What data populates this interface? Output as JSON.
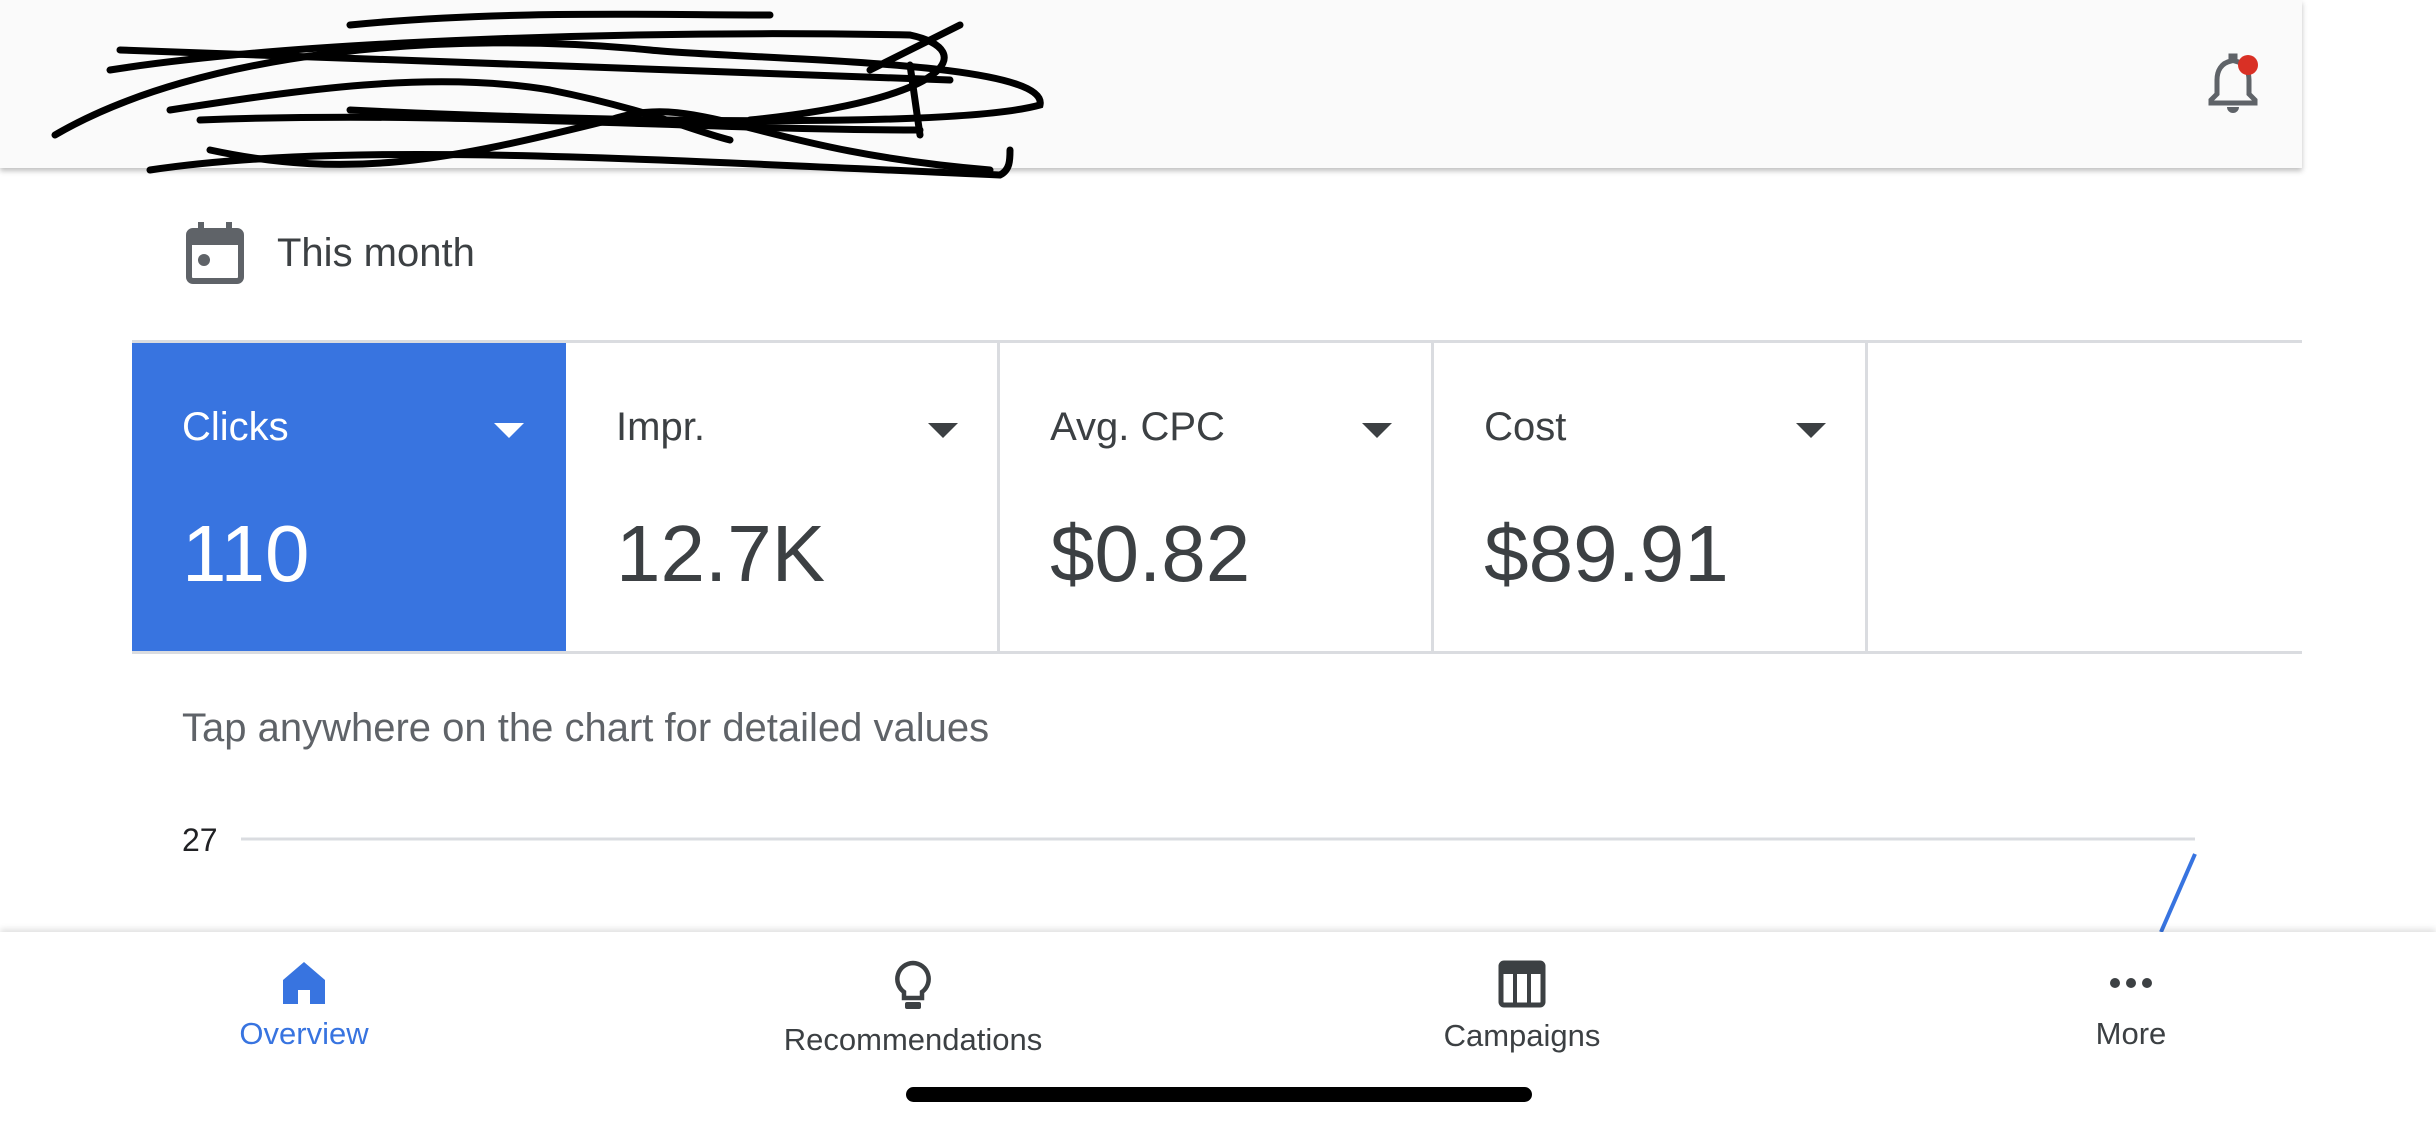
{
  "header": {
    "notification_dot_color": "#d93025"
  },
  "date_range": {
    "label": "This month",
    "icon": "calendar-icon"
  },
  "metrics": [
    {
      "label": "Clicks",
      "value": "110",
      "selected": true
    },
    {
      "label": "Impr.",
      "value": "12.7K",
      "selected": false
    },
    {
      "label": "Avg. CPC",
      "value": "$0.82",
      "selected": false
    },
    {
      "label": "Cost",
      "value": "$89.91",
      "selected": false
    }
  ],
  "chart": {
    "hint": "Tap anywhere on the chart for detailed values",
    "y_tick_top": "27",
    "line_color": "#3874e0"
  },
  "nav": [
    {
      "label": "Overview",
      "icon": "home-icon",
      "active": true
    },
    {
      "label": "Recommendations",
      "icon": "lightbulb-icon"
    },
    {
      "label": "Campaigns",
      "icon": "table-icon"
    },
    {
      "label": "More",
      "icon": "more-horiz-icon"
    }
  ],
  "colors": {
    "accent": "#3874e0"
  }
}
